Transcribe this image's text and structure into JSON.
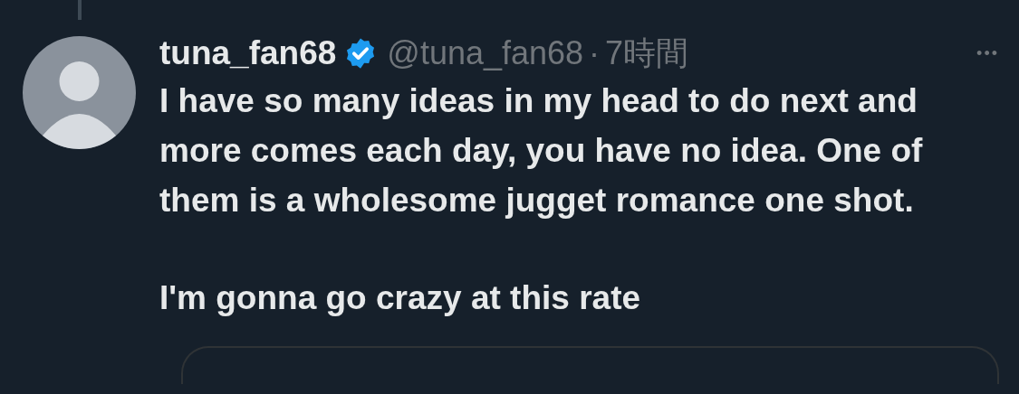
{
  "tweet": {
    "display_name": "tuna_fan68",
    "verified": true,
    "handle": "@tuna_fan68",
    "separator": "·",
    "time": "7時間",
    "more": "•••",
    "paragraphs": [
      "I have so many ideas in my head to do next and more comes each day, you have no idea. One of them is a wholesome jugget romance one shot.",
      "I'm gonna go crazy at this rate"
    ]
  }
}
